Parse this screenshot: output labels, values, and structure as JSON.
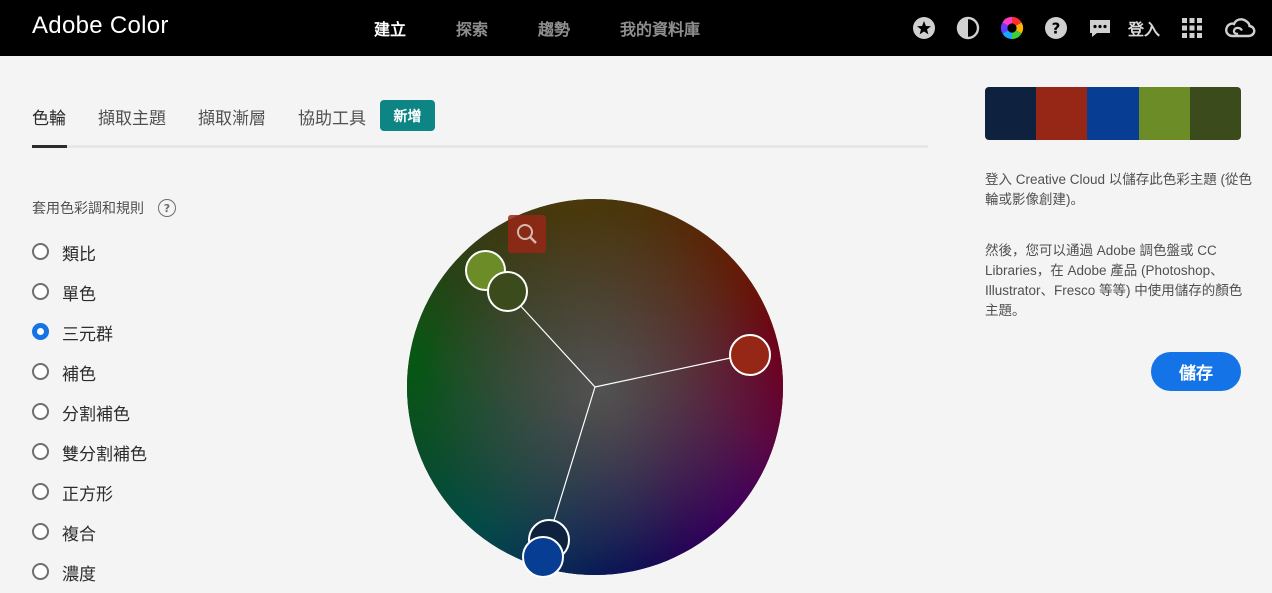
{
  "app": {
    "title": "Adobe Color"
  },
  "nav": {
    "items": [
      "建立",
      "探索",
      "趨勢",
      "我的資料庫"
    ],
    "active": "建立"
  },
  "topbar": {
    "signin_label": "登入",
    "icons": [
      "star-icon",
      "contrast-icon",
      "color-wheel-icon",
      "help-icon",
      "chat-icon",
      "apps-grid-icon",
      "creative-cloud-icon"
    ]
  },
  "tabs": {
    "items": [
      "色輪",
      "擷取主題",
      "擷取漸層",
      "協助工具"
    ],
    "active": "色輪",
    "new_badge": "新增"
  },
  "harmony": {
    "heading": "套用色彩調和規則",
    "help_label": "?",
    "rules": [
      "類比",
      "單色",
      "三元群",
      "補色",
      "分割補色",
      "雙分割補色",
      "正方形",
      "複合",
      "濃度"
    ],
    "selected": "三元群"
  },
  "wheel": {
    "picker_icon": "magnifier-icon"
  },
  "theme": {
    "swatches": [
      "#0e213f",
      "#962717",
      "#073e93",
      "#6b8c26",
      "#3b4b1b"
    ],
    "base_index": 2
  },
  "panel": {
    "message1": "登入 Creative Cloud 以儲存此色彩主題 (從色輪或影像創建)。",
    "message2": "然後，您可以通過 Adobe 調色盤或 CC Libraries，在 Adobe 產品 (Photoshop、Illustrator、Fresco 等等) 中使用儲存的顏色主題。",
    "save_label": "儲存"
  },
  "colors": {
    "accent": "#1473e6",
    "badge": "#0d8585",
    "topbar": "#000000"
  }
}
